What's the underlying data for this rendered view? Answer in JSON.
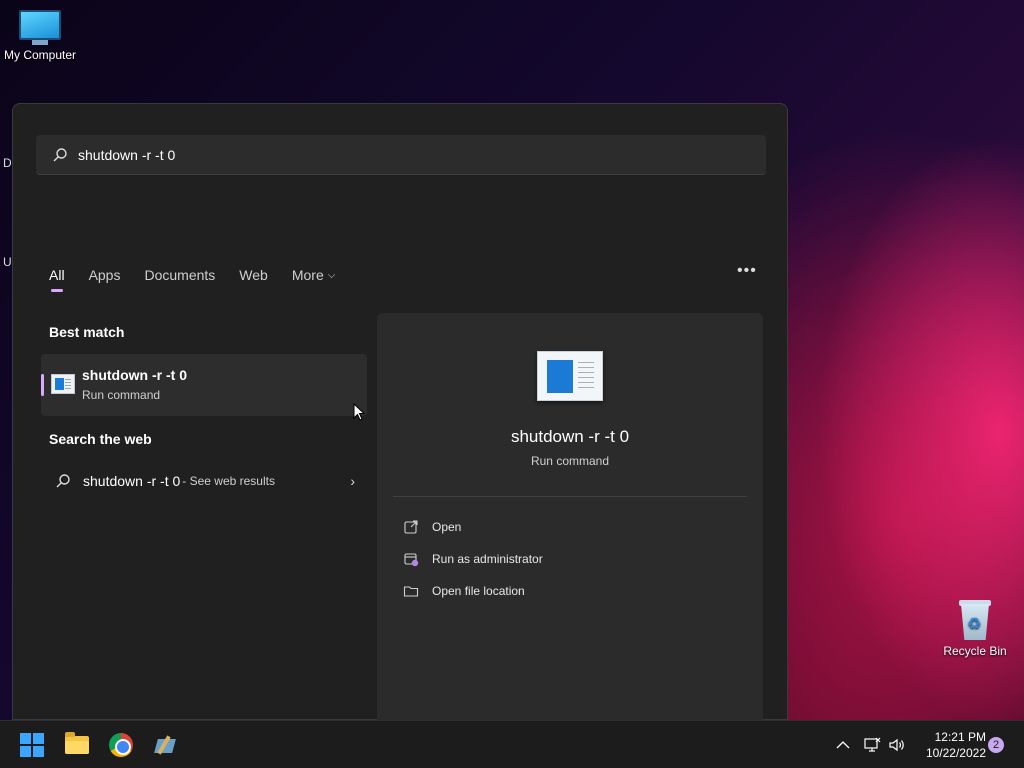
{
  "desktop": {
    "icons": [
      {
        "label": "My Computer",
        "icon": "monitor-icon"
      },
      {
        "label": "Recycle Bin",
        "icon": "recycle-bin-icon"
      }
    ],
    "edge_fragments": [
      "Da",
      "Ur"
    ]
  },
  "search": {
    "query": "shutdown -r -t 0",
    "icon": "search-icon"
  },
  "tabs": [
    {
      "label": "All",
      "active": true
    },
    {
      "label": "Apps"
    },
    {
      "label": "Documents"
    },
    {
      "label": "Web"
    },
    {
      "label": "More"
    }
  ],
  "more_options_icon": "ellipsis-icon",
  "best_match": {
    "heading": "Best match",
    "title": "shutdown -r -t 0",
    "subtitle": "Run command",
    "icon": "run-command-icon"
  },
  "web": {
    "heading": "Search the web",
    "query": "shutdown -r -t 0",
    "suffix": "- See web results"
  },
  "detail": {
    "title": "shutdown -r -t 0",
    "subtitle": "Run command",
    "actions": [
      {
        "label": "Open",
        "icon": "open-external-icon"
      },
      {
        "label": "Run as administrator",
        "icon": "shield-icon"
      },
      {
        "label": "Open file location",
        "icon": "folder-icon"
      }
    ]
  },
  "taskbar": {
    "apps": [
      "start-icon",
      "file-explorer-icon",
      "chrome-icon",
      "tool-icon"
    ],
    "clock": {
      "time": "12:21 PM",
      "date": "10/22/2022"
    },
    "notification_count": "2"
  }
}
